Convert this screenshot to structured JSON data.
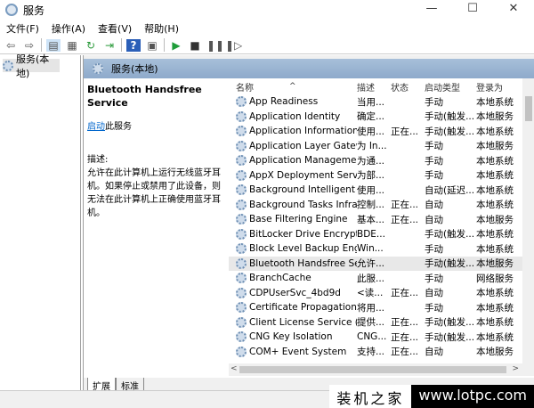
{
  "window": {
    "title": "服务",
    "controls": [
      "—",
      "☐",
      "✕"
    ]
  },
  "menu": [
    "文件(F)",
    "操作(A)",
    "查看(V)",
    "帮助(H)"
  ],
  "tree": {
    "root": "服务(本地)"
  },
  "pane_header": "服务(本地)",
  "detail": {
    "service_name": "Bluetooth Handsfree Service",
    "start_link": "启动",
    "start_suffix": "此服务",
    "desc_label": "描述:",
    "desc_text": "允许在此计算机上运行无线蓝牙耳机。如果停止或禁用了此设备，则无法在此计算机上正确使用蓝牙耳机。"
  },
  "columns": [
    "名称",
    "描述",
    "状态",
    "启动类型",
    "登录为"
  ],
  "rows": [
    [
      "App Readiness",
      "当用...",
      "",
      "手动",
      "本地系统"
    ],
    [
      "Application Identity",
      "确定...",
      "",
      "手动(触发...",
      "本地服务"
    ],
    [
      "Application Information",
      "使用...",
      "正在...",
      "手动(触发...",
      "本地系统"
    ],
    [
      "Application Layer Gatewa...",
      "为 In...",
      "",
      "手动",
      "本地服务"
    ],
    [
      "Application Management",
      "为通...",
      "",
      "手动",
      "本地系统"
    ],
    [
      "AppX Deployment Servic...",
      "为部...",
      "",
      "手动",
      "本地系统"
    ],
    [
      "Background Intelligent T...",
      "使用...",
      "",
      "自动(延迟...",
      "本地系统"
    ],
    [
      "Background Tasks Infras...",
      "控制...",
      "正在...",
      "自动",
      "本地系统"
    ],
    [
      "Base Filtering Engine",
      "基本...",
      "正在...",
      "自动",
      "本地服务"
    ],
    [
      "BitLocker Drive Encryptio...",
      "BDE...",
      "",
      "手动(触发...",
      "本地系统"
    ],
    [
      "Block Level Backup Engi...",
      "Win...",
      "",
      "手动",
      "本地系统"
    ],
    [
      "Bluetooth Handsfree Ser...",
      "允许...",
      "",
      "手动(触发...",
      "本地服务"
    ],
    [
      "BranchCache",
      "此服...",
      "",
      "手动",
      "网络服务"
    ],
    [
      "CDPUserSvc_4bd9d",
      "<读...",
      "正在...",
      "自动",
      "本地系统"
    ],
    [
      "Certificate Propagation",
      "将用...",
      "",
      "手动",
      "本地系统"
    ],
    [
      "Client License Service (Cli...",
      "提供...",
      "正在...",
      "手动(触发...",
      "本地系统"
    ],
    [
      "CNG Key Isolation",
      "CNG...",
      "正在...",
      "手动(触发...",
      "本地系统"
    ],
    [
      "COM+ Event System",
      "支持...",
      "正在...",
      "自动",
      "本地服务"
    ]
  ],
  "selected_row": 11,
  "tabs": [
    "扩展",
    "标准"
  ],
  "watermark": {
    "cn": "装机之家",
    "url": "www.lotpc.com"
  }
}
